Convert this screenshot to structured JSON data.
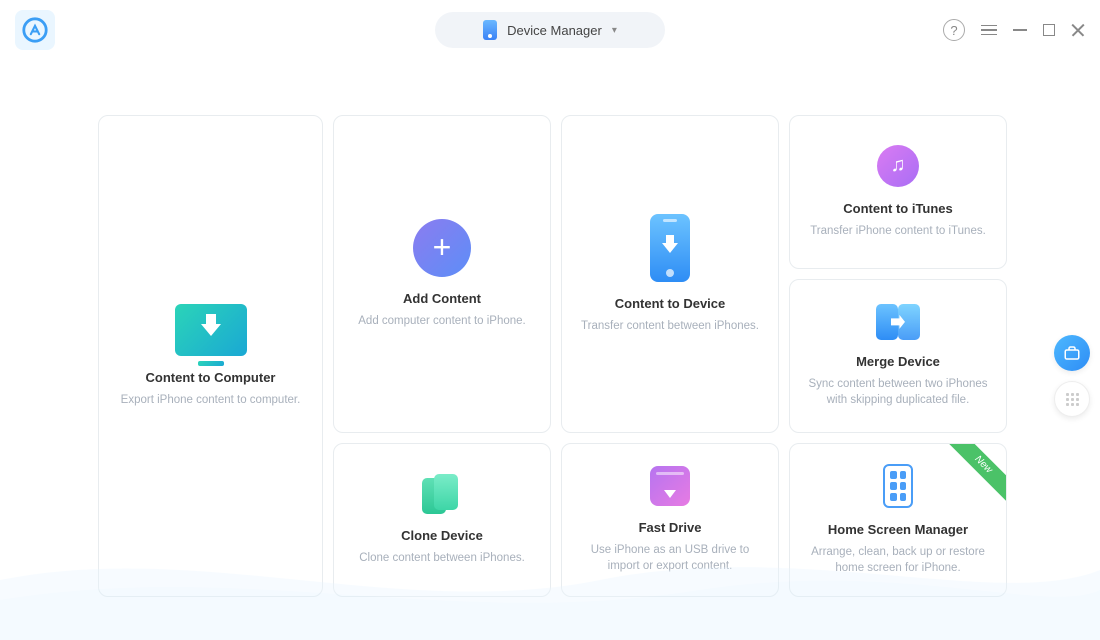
{
  "titlebar": {
    "device_label": "Device Manager"
  },
  "cards": {
    "content_to_computer": {
      "title": "Content to Computer",
      "desc": "Export iPhone content to computer."
    },
    "add_content": {
      "title": "Add Content",
      "desc": "Add computer content to iPhone."
    },
    "content_to_device": {
      "title": "Content to Device",
      "desc": "Transfer content between iPhones."
    },
    "content_to_itunes": {
      "title": "Content to iTunes",
      "desc": "Transfer iPhone content to iTunes."
    },
    "merge_device": {
      "title": "Merge Device",
      "desc": "Sync content between two iPhones with skipping duplicated file."
    },
    "clone_device": {
      "title": "Clone Device",
      "desc": "Clone content between iPhones."
    },
    "fast_drive": {
      "title": "Fast Drive",
      "desc": "Use iPhone as an USB drive to import or export content."
    },
    "home_screen_manager": {
      "title": "Home Screen Manager",
      "desc": "Arrange, clean, back up or restore home screen for iPhone.",
      "badge": "New"
    }
  }
}
